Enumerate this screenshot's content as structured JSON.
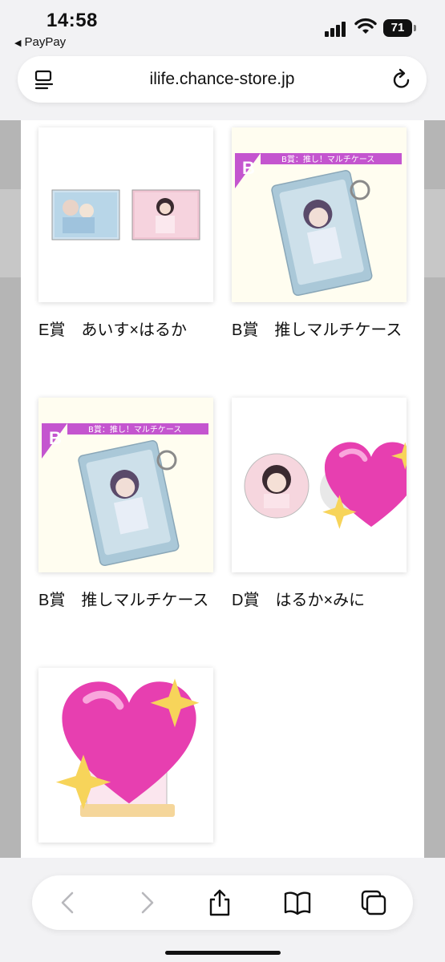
{
  "status_bar": {
    "time": "14:58",
    "back_app": "PayPay",
    "battery": "71"
  },
  "browser": {
    "url": "ilife.chance-store.jp"
  },
  "products": [
    {
      "caption": "E賞　あいす×はるか"
    },
    {
      "caption": "B賞　推しマルチケース",
      "banner_letter": "B",
      "banner_text": "B賞：推し！マルチケース"
    },
    {
      "caption": "B賞　推しマルチケース",
      "banner_letter": "B",
      "banner_text": "B賞：推し！マルチケース"
    },
    {
      "caption": "D賞　はるか×みに"
    },
    {
      "caption": ""
    }
  ],
  "toolbar": {
    "icons": [
      "back-icon",
      "forward-icon",
      "share-icon",
      "bookmarks-icon",
      "tabs-icon"
    ]
  },
  "colors": {
    "accent_magenta": "#c455cf",
    "heart_pink": "#e73fb0",
    "sparkle_yellow": "#f7d45a"
  }
}
